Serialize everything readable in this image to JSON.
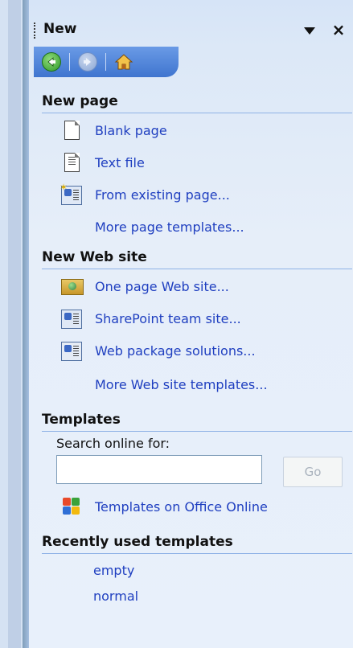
{
  "pane": {
    "title": "New",
    "close_symbol": "×"
  },
  "nav": {
    "back_icon": "back-arrow-icon",
    "forward_icon": "forward-arrow-icon",
    "home_icon": "home-icon"
  },
  "new_page": {
    "heading": "New page",
    "items": [
      {
        "label": "Blank page",
        "icon": "blank-page-icon"
      },
      {
        "label": "Text file",
        "icon": "text-file-icon"
      },
      {
        "label": "From existing page...",
        "icon": "existing-page-icon"
      },
      {
        "label": "More page templates...",
        "icon": ""
      }
    ]
  },
  "new_web_site": {
    "heading": "New Web site",
    "items": [
      {
        "label": "One page Web site...",
        "icon": "web-site-icon"
      },
      {
        "label": "SharePoint team site...",
        "icon": "sharepoint-site-icon"
      },
      {
        "label": "Web package solutions...",
        "icon": "web-package-icon"
      },
      {
        "label": "More Web site templates...",
        "icon": ""
      }
    ]
  },
  "templates": {
    "heading": "Templates",
    "search_label": "Search online for:",
    "search_value": "",
    "go_label": "Go",
    "office_online_label": "Templates on Office Online"
  },
  "recent": {
    "heading": "Recently used templates",
    "items": [
      "empty",
      "normal"
    ]
  },
  "colors": {
    "link": "#1f3fc0",
    "rule": "#8fb2e6",
    "nav_bar": "#3f75cf"
  }
}
